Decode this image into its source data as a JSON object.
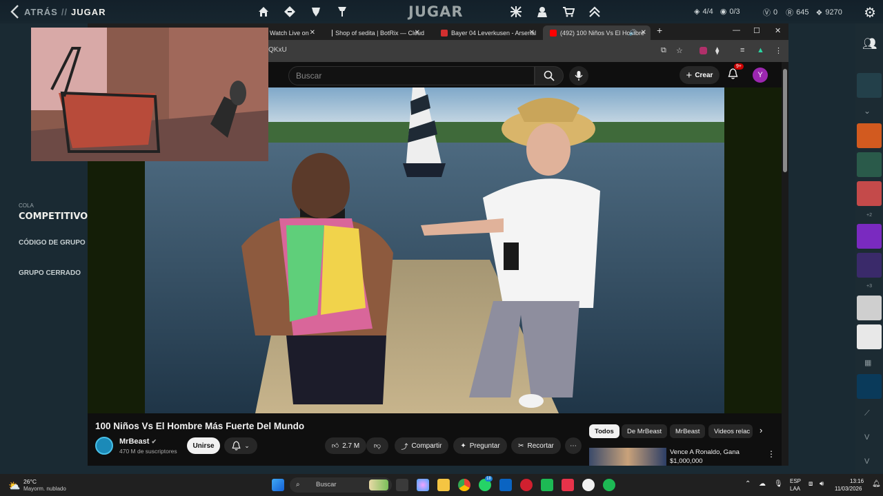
{
  "client": {
    "breadcrumb_back": "ATRÁS",
    "breadcrumb_sep": "//",
    "breadcrumb_current": "JUGAR",
    "title": "JUGAR",
    "stat_party": "4/4",
    "stat_tokens": "0/3",
    "stat_valor": "0",
    "stat_radiant": "645",
    "stat_currency": "9270",
    "queue_label": "COLA",
    "queue_mode": "COMPETITIVO",
    "group_code": "CÓDIGO DE GRUPO",
    "group_closed": "GRUPO CERRADO",
    "rail_more_1": "+2",
    "rail_more_2": "+3"
  },
  "browser": {
    "tabs": [
      {
        "label": "Watch Live on",
        "active": false
      },
      {
        "label": "Shop of sedita | BotRix — Cloud",
        "active": false
      },
      {
        "label": "Bayer 04 Leverkusen - Arsenal",
        "active": false
      },
      {
        "label": "(492) 100 Niños Vs El Hombre",
        "active": true
      }
    ],
    "url_fragment": "QKxU"
  },
  "youtube": {
    "search_placeholder": "Buscar",
    "create_label": "Crear",
    "notif_badge": "9+",
    "avatar_letter": "Y",
    "video_title": "100 Niños Vs El Hombre Más Fuerte Del Mundo",
    "channel_name": "MrBeast",
    "subscribers": "470 M de suscriptores",
    "join_label": "Unirse",
    "likes": "2.7 M",
    "share_label": "Compartir",
    "ask_label": "Preguntar",
    "clip_label": "Recortar",
    "chips": [
      "Todos",
      "De MrBeast",
      "MrBeast",
      "Videos relac"
    ],
    "rec_title_1": "Vence A Ronaldo, Gana",
    "rec_title_2": "$1,000,000"
  },
  "taskbar": {
    "weather_temp": "26°C",
    "weather_desc": "Mayorm. nublado",
    "search_label": "Buscar",
    "lang_1": "ESP",
    "lang_2": "LAA",
    "time": "13:16",
    "date": "11/03/2026",
    "whatsapp_badge": "18"
  },
  "colors": {
    "accent_youtube_red": "#cc0000",
    "riot_bg": "#1a2a33",
    "yt_bg": "#0f0f0f"
  }
}
